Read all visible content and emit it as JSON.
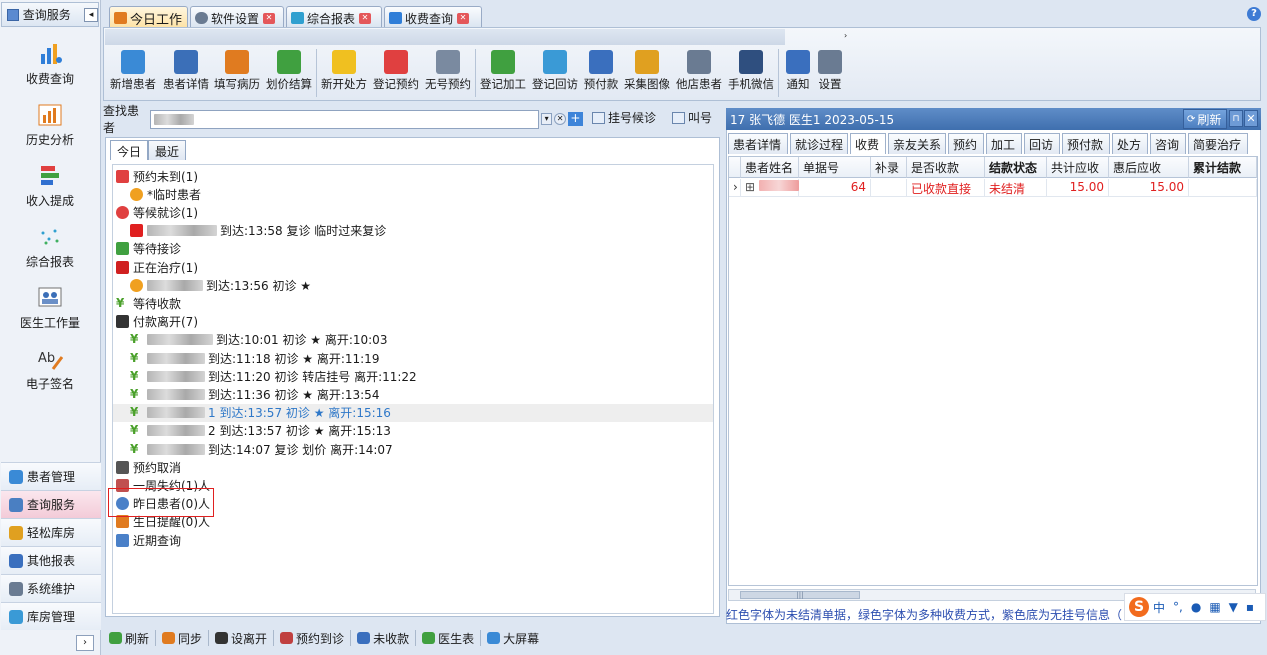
{
  "sidebar": {
    "header_title": "查询服务",
    "big_items": [
      {
        "label": "收费查询",
        "icon": "chart-person-icon"
      },
      {
        "label": "历史分析",
        "icon": "bar-chart-icon"
      },
      {
        "label": "收入提成",
        "icon": "stacked-bars-icon"
      },
      {
        "label": "综合报表",
        "icon": "scatter-icon"
      },
      {
        "label": "医生工作量",
        "icon": "doctor-board-icon"
      },
      {
        "label": "电子签名",
        "icon": "signature-icon"
      }
    ],
    "nav": [
      {
        "label": "患者管理",
        "color": "#3a8ad6"
      },
      {
        "label": "查询服务",
        "color": "#4a7fc2",
        "selected": true
      },
      {
        "label": "轻松库房",
        "color": "#e0a020"
      },
      {
        "label": "其他报表",
        "color": "#3a6fbe"
      },
      {
        "label": "系统维护",
        "color": "#6a7b92"
      },
      {
        "label": "库房管理",
        "color": "#3a9ad6"
      }
    ]
  },
  "tabs": [
    {
      "label": "今日工作",
      "active": true
    },
    {
      "label": "软件设置"
    },
    {
      "label": "综合报表"
    },
    {
      "label": "收费查询"
    }
  ],
  "ribbon": {
    "group_a": [
      "新增患者",
      "患者详情",
      "填写病历",
      "划价结算",
      "新开处方",
      "登记预约",
      "无号预约",
      "登记加工",
      "登记回访",
      "预付款",
      "采集图像",
      "他店患者",
      "手机微信"
    ],
    "group_b": [
      "通知",
      "设置"
    ]
  },
  "find": {
    "label": "查找患者",
    "value_blurred": true,
    "queue_button": "挂号候诊",
    "call_button": "叫号"
  },
  "day_tabs": [
    "今日",
    "最近"
  ],
  "tree": [
    {
      "text": "预约未到(1)",
      "level": 0,
      "icon": "calendar-icon"
    },
    {
      "text": "*临时患者",
      "level": 1,
      "icon": "face-icon"
    },
    {
      "text": "等候就诊(1)",
      "level": 0,
      "icon": "clock-icon"
    },
    {
      "text": "到达:13:58 复诊 临时过来复诊",
      "level": 1,
      "icon": "red-badge-icon",
      "blur": 70
    },
    {
      "text": "等待接诊",
      "level": 0,
      "icon": "people-icon"
    },
    {
      "text": "正在治疗(1)",
      "level": 0,
      "icon": "drop-icon"
    },
    {
      "text": "到达:13:56 初诊 ★",
      "level": 1,
      "icon": "face-icon",
      "blur": 56
    },
    {
      "text": "等待收款",
      "level": 0,
      "icon": "yen-icon"
    },
    {
      "text": "付款离开(7)",
      "level": 0,
      "icon": "walk-icon"
    },
    {
      "text": "到达:10:01 初诊 ★ 离开:10:03",
      "level": 1,
      "icon": "yen-icon",
      "blur": 66
    },
    {
      "text": "到达:11:18 初诊 ★ 离开:11:19",
      "level": 1,
      "icon": "yen-icon",
      "blur": 58
    },
    {
      "text": "到达:11:20 初诊 转店挂号 离开:11:22",
      "level": 1,
      "icon": "yen-icon",
      "blur": 58
    },
    {
      "text": "到达:11:36 初诊 ★ 离开:13:54",
      "level": 1,
      "icon": "yen-icon",
      "blur": 58
    },
    {
      "text": "1 到达:13:57 初诊 ★ 离开:15:16",
      "level": 1,
      "icon": "yen-icon",
      "blur": 58,
      "highlight": true
    },
    {
      "text": "2 到达:13:57 初诊 ★ 离开:15:13",
      "level": 1,
      "icon": "yen-icon",
      "blur": 58
    },
    {
      "text": "到达:14:07 复诊 划价 离开:14:07",
      "level": 1,
      "icon": "yen-icon",
      "blur": 58
    },
    {
      "text": "预约取消",
      "level": 0,
      "icon": "grid-icon"
    },
    {
      "text": "一周失约(1)人",
      "level": 0,
      "icon": "list-icon"
    },
    {
      "text": "昨日患者(0)人",
      "level": 0,
      "icon": "eye-icon"
    },
    {
      "text": "生日提醒(0)人",
      "level": 0,
      "icon": "cake-icon"
    },
    {
      "text": "近期查询",
      "level": 0,
      "icon": "search-icon"
    }
  ],
  "right_panel": {
    "title": "17 张飞德 医生1 2023-05-15",
    "refresh": "刷新",
    "tabs": [
      "患者详情",
      "就诊过程",
      "收费",
      "亲友关系",
      "预约",
      "加工",
      "回访",
      "预付款",
      "处方",
      "咨询",
      "简要治疗"
    ],
    "active_tab": "收费",
    "columns": [
      "患者姓名",
      "单据号",
      "补录",
      "是否收款",
      "结款状态",
      "共计应收",
      "惠后应收",
      "累计结款"
    ],
    "rows": [
      {
        "name_blurred": true,
        "doc_no": "64",
        "supplement": "",
        "paid": "已收款直接",
        "status": "未结清",
        "total": "15.00",
        "after_discount": "15.00",
        "settled": ""
      }
    ],
    "legend": "红色字体为未结清单据，绿色字体为多种收费方式，紫色底为无挂号信息（即没有挂号）"
  },
  "ime": {
    "logo": "S",
    "lang": "中",
    "punct": "°,"
  },
  "bottom": [
    "刷新",
    "同步",
    "设离开",
    "预约到诊",
    "未收款",
    "医生表",
    "大屏幕"
  ]
}
